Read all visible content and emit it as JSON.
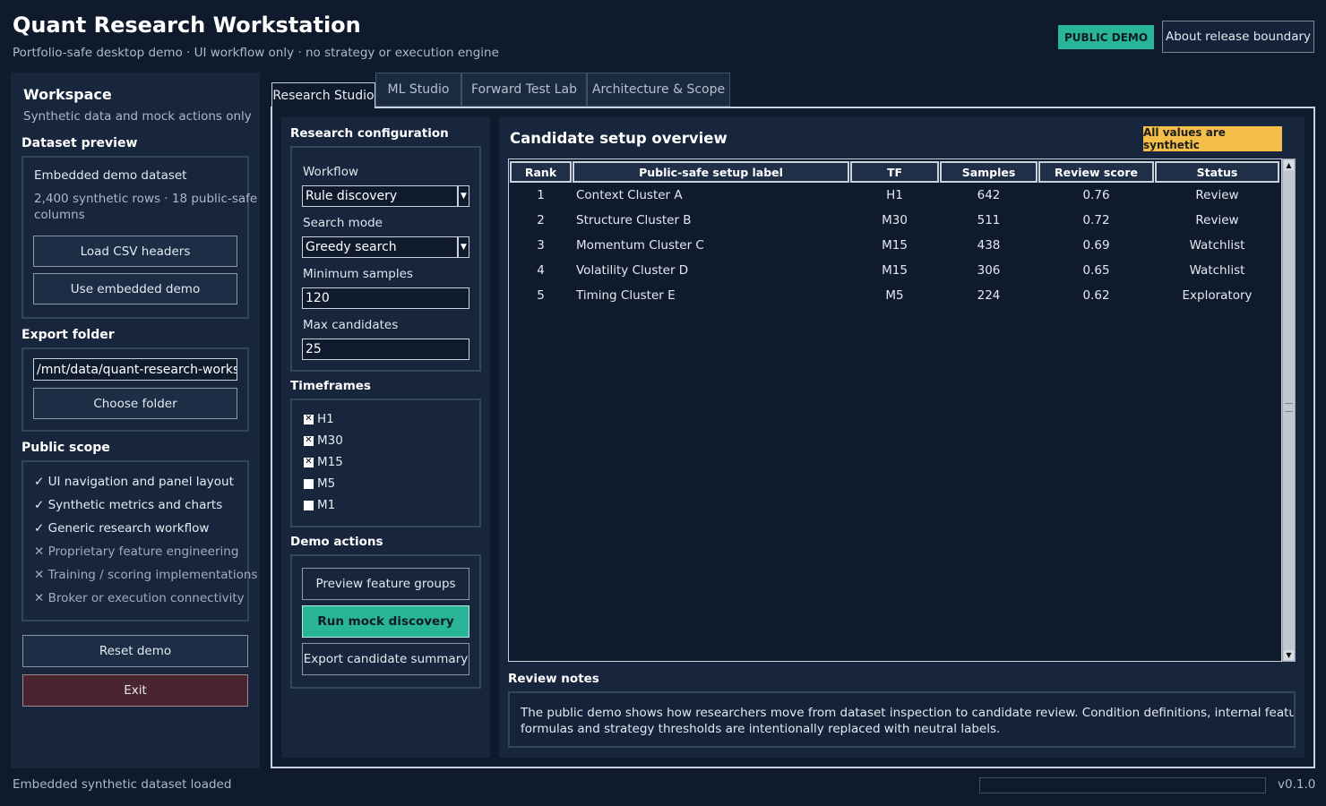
{
  "header": {
    "title": "Quant Research Workstation",
    "subtitle": "Portfolio-safe desktop demo · UI workflow only · no strategy or execution engine",
    "badge": "PUBLIC DEMO",
    "about_button": "About release boundary"
  },
  "sidebar": {
    "title": "Workspace",
    "subtitle": "Synthetic data and mock actions only",
    "dataset": {
      "heading": "Dataset preview",
      "name": "Embedded demo dataset",
      "desc_line1": "2,400 synthetic rows · 18 public-safe",
      "desc_line2": "columns",
      "load_button": "Load CSV headers",
      "use_button": "Use embedded demo"
    },
    "export": {
      "heading": "Export folder",
      "path": "/mnt/data/quant-research-workstation",
      "choose_button": "Choose folder"
    },
    "scope": {
      "heading": "Public scope",
      "items": [
        {
          "mark": "✓",
          "text": "UI navigation and panel layout"
        },
        {
          "mark": "✓",
          "text": "Synthetic metrics and charts"
        },
        {
          "mark": "✓",
          "text": "Generic research workflow"
        },
        {
          "mark": "✕",
          "text": "Proprietary feature engineering"
        },
        {
          "mark": "✕",
          "text": "Training / scoring implementations"
        },
        {
          "mark": "✕",
          "text": "Broker or execution connectivity"
        }
      ]
    },
    "reset_button": "Reset demo",
    "exit_button": "Exit"
  },
  "tabs": [
    {
      "label": "Research Studio",
      "active": true
    },
    {
      "label": "ML Studio",
      "active": false
    },
    {
      "label": "Forward Test Lab",
      "active": false
    },
    {
      "label": "Architecture & Scope",
      "active": false
    }
  ],
  "config": {
    "heading": "Research configuration",
    "workflow_label": "Workflow",
    "workflow_value": "Rule discovery",
    "search_mode_label": "Search mode",
    "search_mode_value": "Greedy search",
    "min_samples_label": "Minimum samples",
    "min_samples_value": "120",
    "max_candidates_label": "Max candidates",
    "max_candidates_value": "25",
    "timeframes_heading": "Timeframes",
    "timeframes": [
      {
        "label": "H1",
        "checked": true
      },
      {
        "label": "M30",
        "checked": true
      },
      {
        "label": "M15",
        "checked": true
      },
      {
        "label": "M5",
        "checked": false
      },
      {
        "label": "M1",
        "checked": false
      }
    ],
    "actions_heading": "Demo actions",
    "actions": {
      "preview": "Preview feature groups",
      "run": "Run mock discovery",
      "export": "Export candidate summary"
    }
  },
  "results": {
    "title": "Candidate setup overview",
    "badge": "All values are synthetic",
    "columns": [
      "Rank",
      "Public-safe setup label",
      "TF",
      "Samples",
      "Review score",
      "Status"
    ],
    "rows": [
      [
        "1",
        "Context Cluster A",
        "H1",
        "642",
        "0.76",
        "Review"
      ],
      [
        "2",
        "Structure Cluster B",
        "M30",
        "511",
        "0.72",
        "Review"
      ],
      [
        "3",
        "Momentum Cluster C",
        "M15",
        "438",
        "0.69",
        "Watchlist"
      ],
      [
        "4",
        "Volatility Cluster D",
        "M15",
        "306",
        "0.65",
        "Watchlist"
      ],
      [
        "5",
        "Timing Cluster E",
        "M5",
        "224",
        "0.62",
        "Exploratory"
      ]
    ],
    "notes_heading": "Review notes",
    "notes_line1": "The public demo shows how researchers move from dataset inspection to candidate review. Condition definitions, internal feature names, scoring",
    "notes_line2": "formulas and strategy thresholds are intentionally replaced with neutral labels."
  },
  "footer": {
    "status": "Embedded synthetic dataset loaded",
    "progress": 0,
    "version": "v0.1.0"
  },
  "colors": {
    "background": "#0f1b2d",
    "panel": "#17263c",
    "accent": "#29b597",
    "warning": "#f3bf48",
    "danger": "#4a2530"
  }
}
